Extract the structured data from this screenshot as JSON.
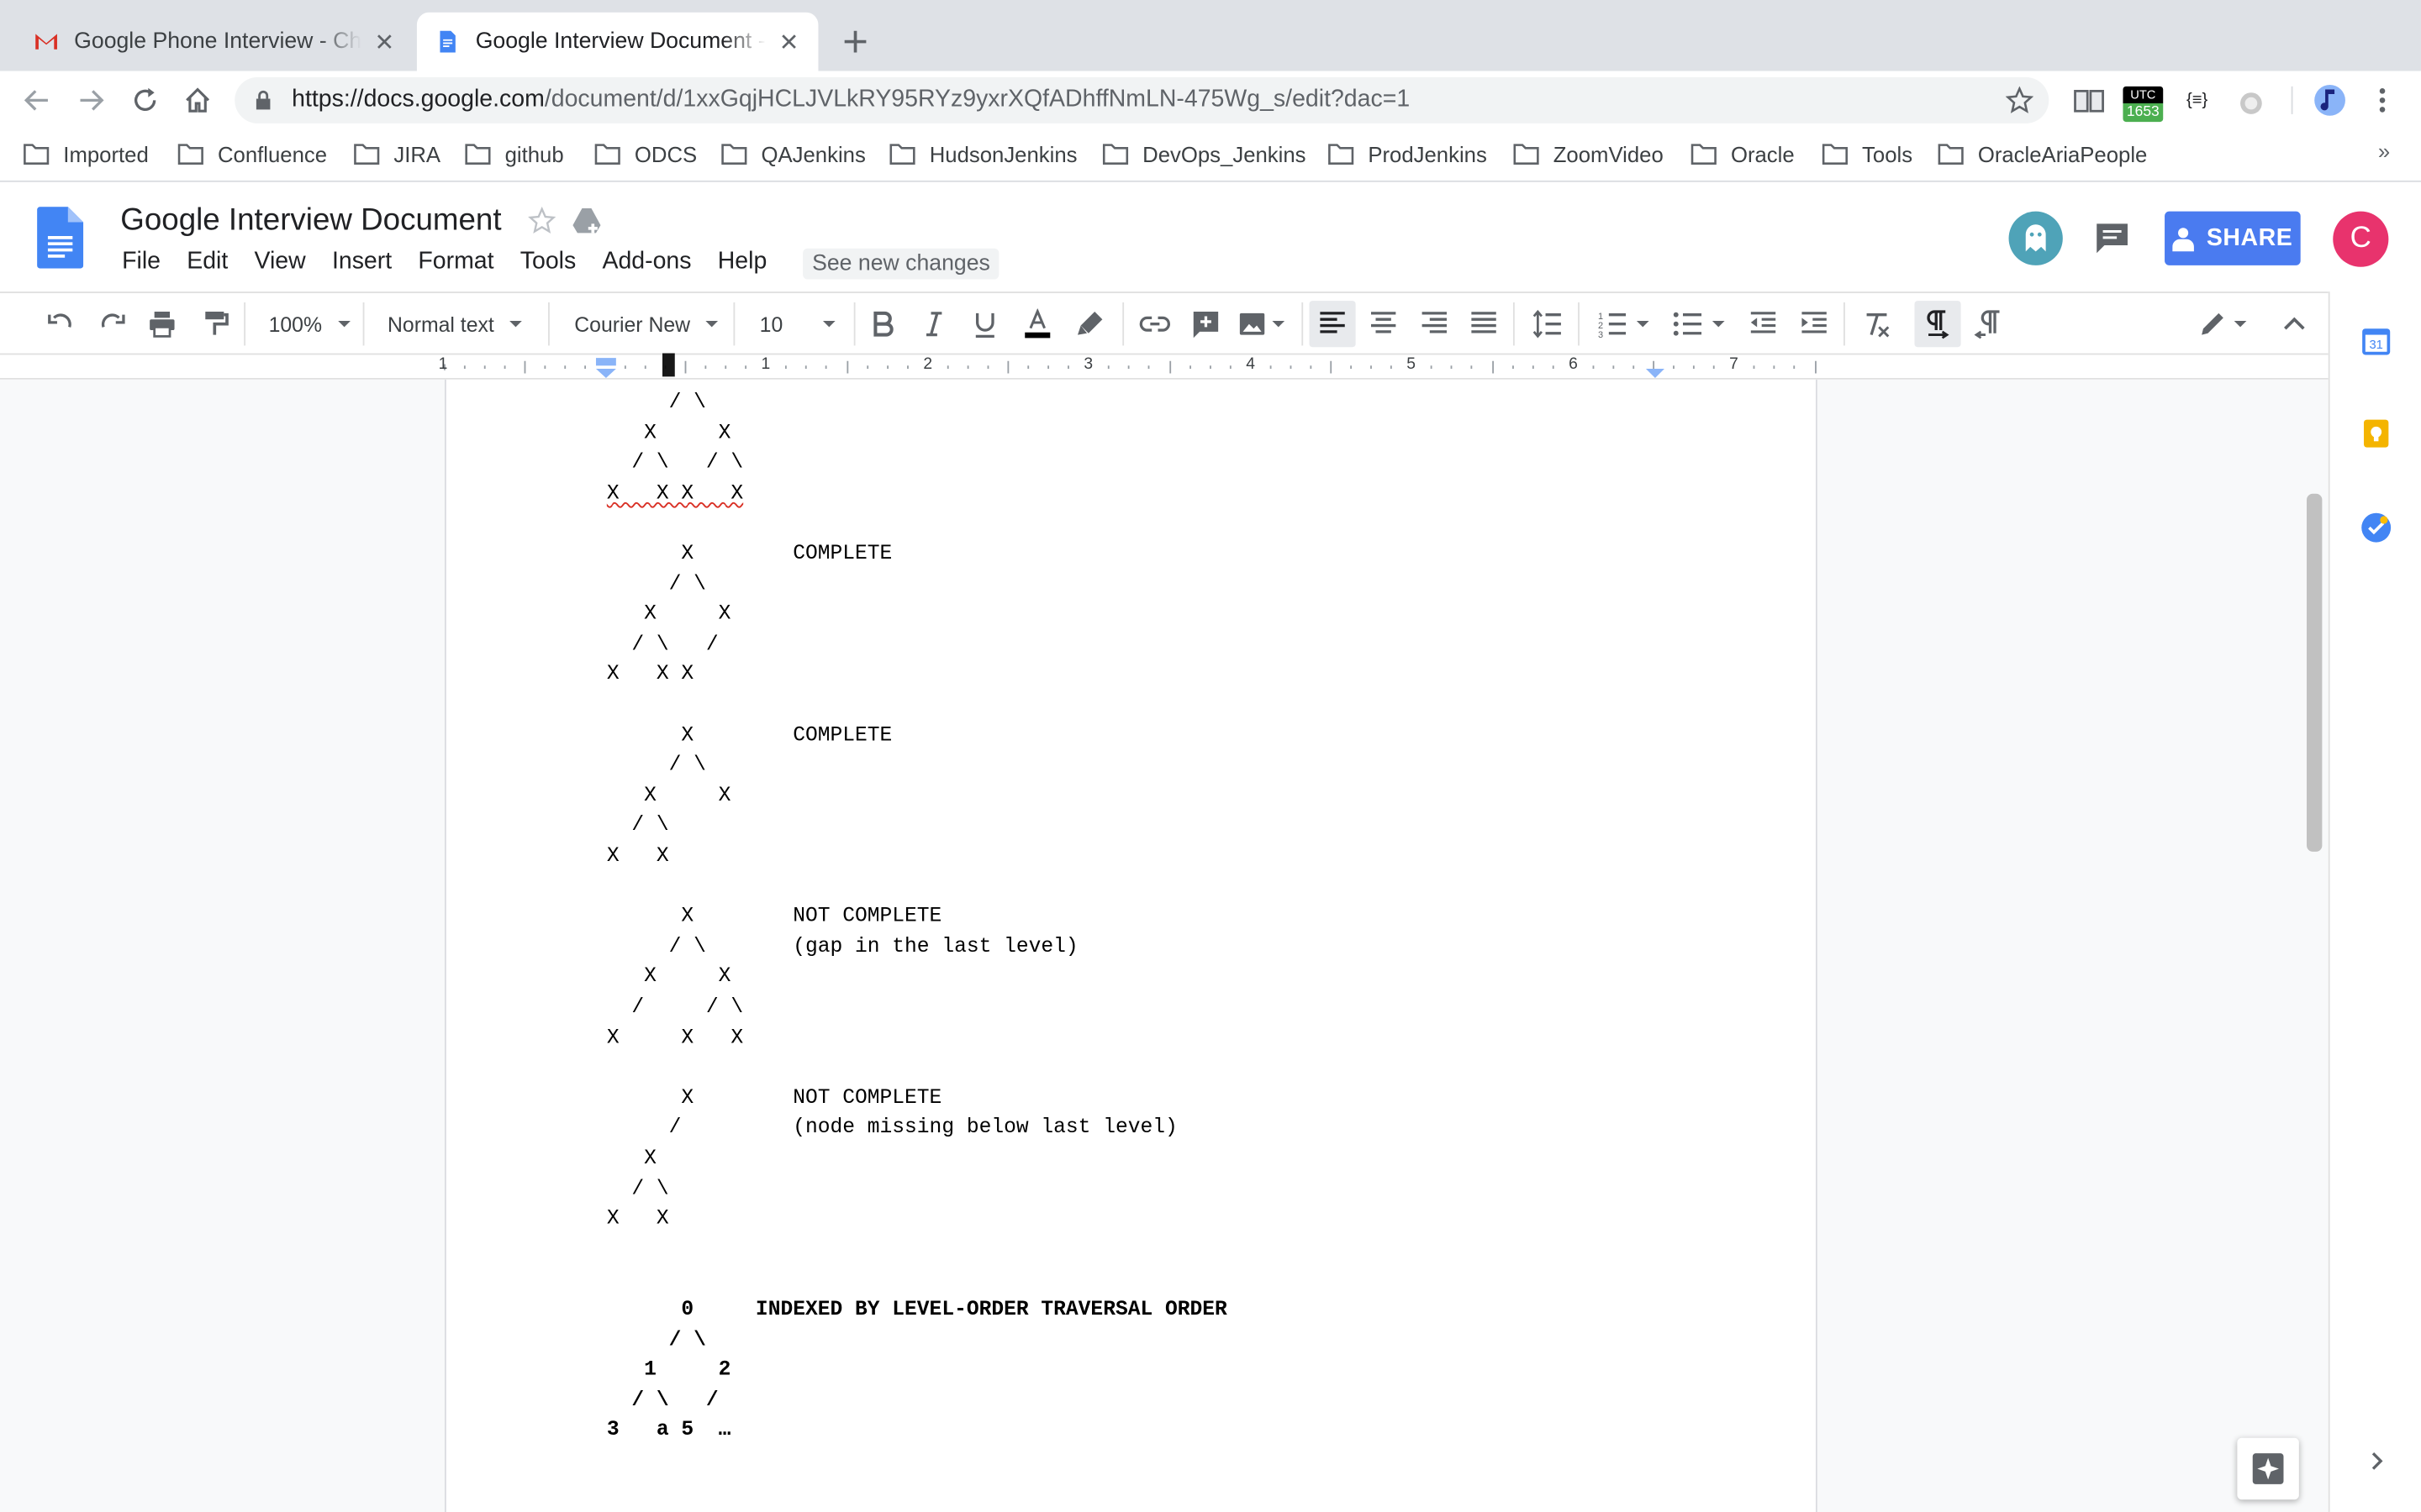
{
  "browser": {
    "tabs": [
      {
        "title": "Google Phone Interview - Chad",
        "icon": "gmail-icon",
        "active": false
      },
      {
        "title": "Google Interview Document - Google Docs",
        "icon": "docs-icon",
        "active": true
      }
    ],
    "url_host": "https://docs.google.com",
    "url_path": "/document/d/1xxGqjHCLJVLkRY95RYz9yxrXQfADhffNmLN-475Wg_s/edit?dac=1",
    "extensions": {
      "utc_label": "UTC",
      "utc_value": "1653",
      "json_label": "{≡}"
    },
    "bookmarks": [
      "Imported",
      "Confluence",
      "JIRA",
      "github",
      "ODCS",
      "QAJenkins",
      "HudsonJenkins",
      "DevOps_Jenkins",
      "ProdJenkins",
      "ZoomVideo",
      "Oracle",
      "Tools",
      "OracleAriaPeople"
    ],
    "bookmarks_more": "»"
  },
  "docs": {
    "title": "Google Interview Document",
    "menu": [
      "File",
      "Edit",
      "View",
      "Insert",
      "Format",
      "Tools",
      "Add-ons",
      "Help"
    ],
    "see_changes": "See new changes",
    "share_label": "SHARE",
    "account_initial": "C",
    "toolbar": {
      "zoom": "100%",
      "style": "Normal text",
      "font": "Courier New",
      "size": "10"
    },
    "ruler_numbers": [
      "1",
      "1",
      "2",
      "3",
      "4",
      "5",
      "6",
      "7"
    ]
  },
  "content": {
    "lines": [
      {
        "text": "     / \\",
        "bold": false
      },
      {
        "text": "   X     X",
        "bold": false
      },
      {
        "text": "  / \\   / \\",
        "bold": false
      },
      {
        "text": "X   X X   X",
        "bold": false,
        "squiggle": true
      },
      {
        "text": "",
        "bold": false
      },
      {
        "text": "      X        COMPLETE",
        "bold": false
      },
      {
        "text": "     / \\",
        "bold": false
      },
      {
        "text": "   X     X",
        "bold": false
      },
      {
        "text": "  / \\   /",
        "bold": false
      },
      {
        "text": "X   X X",
        "bold": false
      },
      {
        "text": "",
        "bold": false
      },
      {
        "text": "      X        COMPLETE",
        "bold": false
      },
      {
        "text": "     / \\",
        "bold": false
      },
      {
        "text": "   X     X",
        "bold": false
      },
      {
        "text": "  / \\",
        "bold": false
      },
      {
        "text": "X   X",
        "bold": false
      },
      {
        "text": "",
        "bold": false
      },
      {
        "text": "      X        NOT COMPLETE",
        "bold": false
      },
      {
        "text": "     / \\       (gap in the last level)",
        "bold": false
      },
      {
        "text": "   X     X",
        "bold": false
      },
      {
        "text": "  /     / \\",
        "bold": false
      },
      {
        "text": "X     X   X",
        "bold": false
      },
      {
        "text": "",
        "bold": false
      },
      {
        "text": "      X        NOT COMPLETE",
        "bold": false
      },
      {
        "text": "     /         (node missing below last level)",
        "bold": false
      },
      {
        "text": "   X",
        "bold": false
      },
      {
        "text": "  / \\",
        "bold": false
      },
      {
        "text": "X   X",
        "bold": false
      },
      {
        "text": "",
        "bold": false
      },
      {
        "text": "",
        "bold": false
      },
      {
        "text": "      0     INDEXED BY LEVEL-ORDER TRAVERSAL ORDER",
        "bold": true
      },
      {
        "text": "     / \\",
        "bold": true
      },
      {
        "text": "   1     2",
        "bold": true
      },
      {
        "text": "  / \\   /",
        "bold": true
      },
      {
        "text": "3   a 5  …",
        "bold": true
      }
    ]
  },
  "side_panel": {
    "calendar_day": "31"
  },
  "colors": {
    "share_blue": "#4a7bf0",
    "avatar_pink": "#e8336d",
    "docs_blue": "#4285f4",
    "keep_yellow": "#f4b400",
    "tasks_blue": "#4285f4"
  }
}
